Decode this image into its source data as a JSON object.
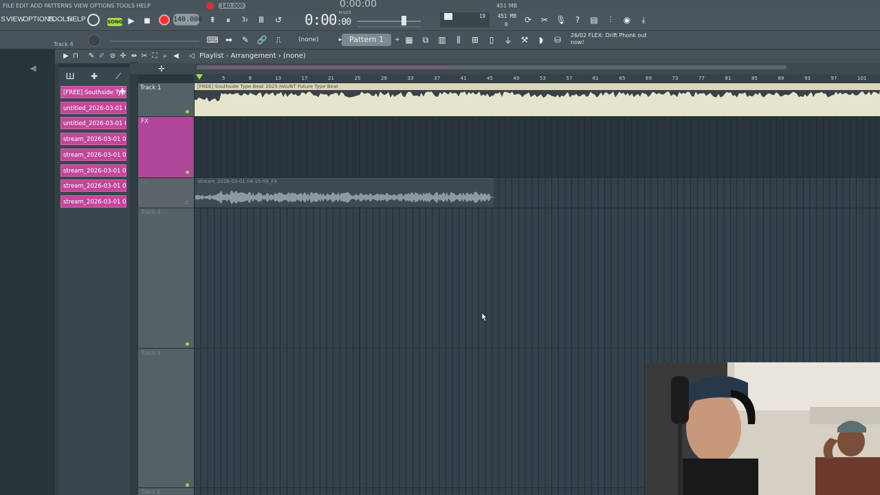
{
  "ghost_bar": {
    "menu": "FILE EDIT ADD PATTERNS VIEW OPTIONS TOOLS HELP",
    "bpm": "140.000",
    "time": "0:00:00",
    "mem": "451 MB"
  },
  "toolbar": {
    "menu_view": "VIEW",
    "menu_options": "OPTIONS",
    "menu_tools": "TOOLS",
    "menu_help": "HELP",
    "menu_prefix": "S",
    "song_mode": "SONG",
    "bpm": "140.000",
    "time_main": "0:00",
    "time_small": ":00",
    "time_sub": "M:S:CS",
    "cpu_value": "19",
    "memory": "451 MB",
    "poly_value": "0",
    "track_label": "Track 4",
    "none_selector": "(none)",
    "pattern": "Pattern 1",
    "news_date": "26/02",
    "news_text": "FLEX: Drift Phonk out now!"
  },
  "playlist": {
    "title": "Playlist - Arrangement",
    "title_sep": "›",
    "arrangement": "(none)",
    "ruler": [
      "5",
      "9",
      "13",
      "17",
      "21",
      "25",
      "29",
      "33",
      "37",
      "41",
      "45",
      "49",
      "53",
      "57",
      "61",
      "65",
      "69",
      "73",
      "77",
      "81",
      "85",
      "89",
      "93",
      "97",
      "101"
    ]
  },
  "picker": {
    "clips": [
      "[FREE] Southside Typ...",
      "untitled_2026-03-01 04-...",
      "untitled_2026-03-01 04-...",
      "stream_2026-03-01 04-...",
      "stream_2026-03-01 04-...",
      "stream_2026-03-01 04-...",
      "stream_2026-03-01 04-...",
      "stream_2026-03-01 04-..."
    ]
  },
  "tracks": {
    "track1": "Track 1",
    "track2": "FX",
    "track3": "FX",
    "track4": "Track 4",
    "track5": "Track 5",
    "track6": "Track 6"
  },
  "clips": {
    "clip1_label": "[FREE] Southside Type Beat 2025 HAUNT Future Type Beat",
    "clip2_label": "stream_2026-03-01 04-15-09_FX"
  },
  "colors": {
    "toolbar": "#4a565d",
    "accent_pink": "#c2479b",
    "song_green": "#a6d84a",
    "record_red": "#e8343a",
    "audio_clip": "#e7e4cc"
  }
}
